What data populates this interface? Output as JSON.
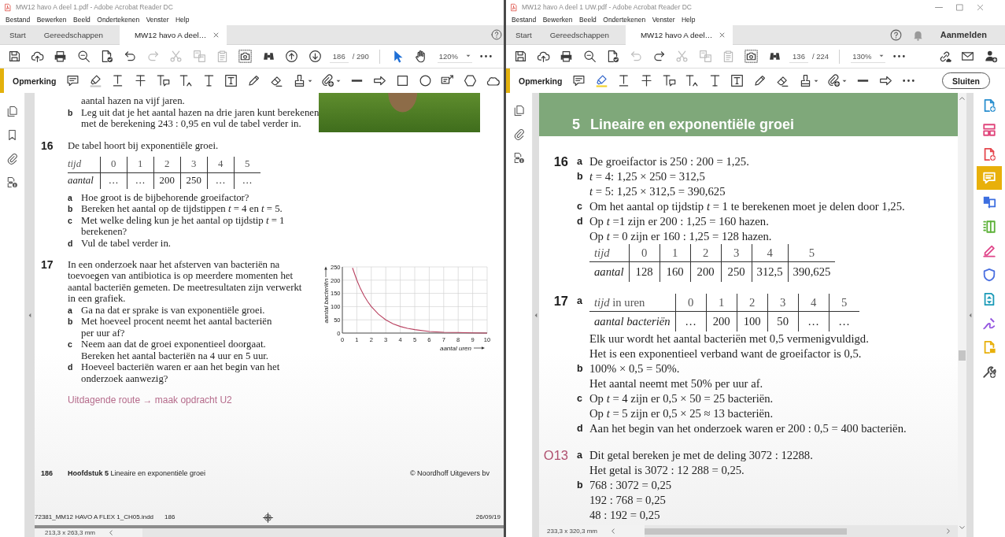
{
  "windows": [
    {
      "title": "MW12 havo A deel 1.pdf - Adobe Acrobat Reader DC",
      "menu": [
        "Bestand",
        "Bewerken",
        "Beeld",
        "Ondertekenen",
        "Venster",
        "Help"
      ],
      "tabs": [
        {
          "label": "Start",
          "selected": false
        },
        {
          "label": "Gereedschappen",
          "selected": false
        },
        {
          "label": "MW12 havo A deel…",
          "selected": true
        }
      ],
      "header_actions": [
        {
          "kind": "help"
        }
      ],
      "toolbar": {
        "tools": [
          {
            "kind": "save",
            "disabled": false
          },
          {
            "kind": "upload",
            "disabled": false
          },
          {
            "kind": "print",
            "disabled": false
          },
          {
            "kind": "zoom-out",
            "disabled": false
          },
          {
            "kind": "sign",
            "disabled": false
          },
          {
            "kind": "undo",
            "disabled": false
          },
          {
            "kind": "redo",
            "disabled": true
          },
          {
            "kind": "cut",
            "disabled": true
          },
          {
            "kind": "copy-pages",
            "disabled": true
          },
          {
            "kind": "clipboard",
            "disabled": true
          },
          {
            "kind": "snapshot",
            "disabled": false
          },
          {
            "kind": "find",
            "disabled": false
          },
          {
            "kind": "page-up",
            "disabled": false
          },
          {
            "kind": "page-down",
            "disabled": false
          }
        ],
        "page": "186",
        "page_total": "/ 290",
        "modes": [
          {
            "kind": "pointer",
            "selected": true
          },
          {
            "kind": "hand",
            "selected": false
          }
        ],
        "zoom": "120%"
      },
      "comment_bar": {
        "label": "Opmerking",
        "tools": [
          {
            "kind": "comment",
            "selected": false
          },
          {
            "kind": "highlight",
            "selected": false
          },
          {
            "kind": "underline",
            "selected": false
          },
          {
            "kind": "strikethrough",
            "selected": false
          },
          {
            "kind": "replace-text",
            "selected": false
          },
          {
            "kind": "insert-text",
            "selected": false
          },
          {
            "kind": "add-text",
            "selected": false
          },
          {
            "kind": "text-box",
            "selected": false
          },
          {
            "kind": "pencil",
            "selected": false
          },
          {
            "kind": "eraser",
            "selected": false
          },
          {
            "kind": "stamp",
            "selected": false
          },
          {
            "kind": "attach",
            "selected": false
          },
          {
            "kind": "line",
            "selected": false
          },
          {
            "kind": "arrow",
            "selected": false
          },
          {
            "kind": "rectangle",
            "selected": false
          },
          {
            "kind": "oval",
            "selected": false
          },
          {
            "kind": "callout",
            "selected": false
          },
          {
            "kind": "polygon",
            "selected": false
          },
          {
            "kind": "cloud",
            "selected": false
          }
        ]
      },
      "side_rail": [
        {
          "kind": "pages"
        },
        {
          "kind": "bookmarks"
        },
        {
          "kind": "attachments"
        },
        {
          "kind": "document-info"
        }
      ],
      "document": {
        "kind": "exercises",
        "photo": true,
        "continuation": [
          {
            "text": "aantal hazen na vijf jaren."
          },
          {
            "letter": "b",
            "text": "Leg uit dat je het aantal hazen na drie jaren kunt berekenen\nmet de berekening 243 : 0,95 en vul de tabel verder in."
          }
        ],
        "exercises": [
          {
            "number": "16",
            "intro": "De tabel hoort bij exponentiële groei.",
            "table": {
              "rows": [
                {
                  "label": "tijd",
                  "italic": true,
                  "cells": [
                    "0",
                    "1",
                    "2",
                    "3",
                    "4",
                    "5"
                  ]
                },
                {
                  "label": "aantal",
                  "italic": true,
                  "cells": [
                    "…",
                    "…",
                    "200",
                    "250",
                    "…",
                    "…"
                  ]
                }
              ]
            },
            "questions": [
              {
                "letter": "a",
                "text": "Hoe groot is de bijbehorende groeifactor?"
              },
              {
                "letter": "b",
                "text": "Bereken het aantal op de tijdstippen *t* = 4 en *t* = 5."
              },
              {
                "letter": "c",
                "text": "Met welke deling kun je het aantal op tijdstip *t* = 1\nberekenen?"
              },
              {
                "letter": "d",
                "text": "Vul de tabel verder in."
              }
            ]
          },
          {
            "number": "17",
            "intro": "In een onderzoek naar het afsterven van bacteriën na\ntoevoegen van antibiotica is op meerdere momenten het\naantal bacteriën gemeten. De meetresultaten zijn verwerkt\nin een grafiek.",
            "questions": [
              {
                "letter": "a",
                "text": "Ga na dat er sprake is van exponentiële groei."
              },
              {
                "letter": "b",
                "text": "Met hoeveel procent neemt het aantal bacteriën\nper uur af?"
              },
              {
                "letter": "c",
                "text": "Neem aan dat de groei exponentieel doorgaat.\nBereken het aantal bacteriën na 4 uur en 5 uur."
              },
              {
                "letter": "d",
                "text": "Hoeveel bacteriën waren er aan het begin van het\nonderzoek aanwezig?"
              }
            ],
            "chart_data": {
              "type": "line",
              "xlabel": "aantal uren",
              "ylabel": "aantal bacteriën",
              "x": [
                0.7,
                1,
                1.25,
                1.5,
                1.75,
                2,
                2.5,
                3,
                3.5,
                4,
                4.5,
                5,
                6,
                7,
                8,
                9,
                10
              ],
              "values": [
                246,
                200,
                168,
                141,
                119,
                100,
                71,
                50,
                35,
                25,
                18,
                13,
                6,
                3,
                2,
                1,
                0
              ],
              "xlim": [
                0,
                10
              ],
              "ylim": [
                0,
                250
              ],
              "xticks": [
                0,
                1,
                2,
                3,
                4,
                5,
                6,
                7,
                8,
                9,
                10
              ],
              "yticks": [
                0,
                50,
                100,
                150,
                200,
                250
              ],
              "grid": true
            }
          }
        ],
        "route": "Uitdagende route → maak opdracht U2",
        "footer": {
          "page": "186",
          "chapter": "**Hoofdstuk 5** Lineaire en exponentiële groei",
          "copyright": "© Noordhoff Uitgevers bv"
        },
        "slug": {
          "file": "72381_MM12 HAVO A FLEX 1_CH05.indd",
          "page": "186",
          "date": "26/09/19"
        }
      },
      "status": "213,3 x 263,3 mm"
    },
    {
      "title": "MW12 havo A deel 1 UW.pdf - Adobe Acrobat Reader DC",
      "window_controls": true,
      "menu": [
        "Bestand",
        "Bewerken",
        "Beeld",
        "Ondertekenen",
        "Venster",
        "Help"
      ],
      "tabs": [
        {
          "label": "Start",
          "selected": false
        },
        {
          "label": "Gereedschappen",
          "selected": false
        },
        {
          "label": "MW12 havo A deel…",
          "selected": true
        }
      ],
      "header_actions": [
        {
          "kind": "help"
        },
        {
          "kind": "notifications"
        },
        {
          "kind": "sign-in",
          "label": "Aanmelden"
        }
      ],
      "toolbar": {
        "tools": [
          {
            "kind": "save",
            "disabled": false
          },
          {
            "kind": "upload",
            "disabled": false
          },
          {
            "kind": "print",
            "disabled": false
          },
          {
            "kind": "zoom-out",
            "disabled": false
          },
          {
            "kind": "sign",
            "disabled": false
          },
          {
            "kind": "undo",
            "disabled": true
          },
          {
            "kind": "redo",
            "disabled": false
          },
          {
            "kind": "cut",
            "disabled": true
          },
          {
            "kind": "copy-pages",
            "disabled": true
          },
          {
            "kind": "clipboard",
            "disabled": true
          },
          {
            "kind": "snapshot",
            "disabled": false
          },
          {
            "kind": "find",
            "disabled": false
          }
        ],
        "page": "136",
        "page_total": "/ 224",
        "zoom": "130%",
        "trailing_tools": [
          {
            "kind": "share-link"
          },
          {
            "kind": "mail"
          },
          {
            "kind": "add-user"
          }
        ]
      },
      "comment_bar": {
        "label": "Opmerking",
        "tools": [
          {
            "kind": "comment",
            "selected": false
          },
          {
            "kind": "highlight",
            "selected": true
          },
          {
            "kind": "underline",
            "selected": false
          },
          {
            "kind": "strikethrough",
            "selected": false
          },
          {
            "kind": "replace-text",
            "selected": false
          },
          {
            "kind": "insert-text",
            "selected": false
          },
          {
            "kind": "add-text",
            "selected": false
          },
          {
            "kind": "text-box",
            "selected": false
          },
          {
            "kind": "pencil",
            "selected": false
          },
          {
            "kind": "eraser",
            "selected": false
          },
          {
            "kind": "stamp",
            "selected": false
          },
          {
            "kind": "attach",
            "selected": false
          },
          {
            "kind": "line",
            "selected": false
          },
          {
            "kind": "arrow",
            "selected": false
          },
          {
            "kind": "more",
            "selected": false
          }
        ],
        "close_label": "Sluiten"
      },
      "side_rail": [
        {
          "kind": "pages"
        },
        {
          "kind": "attachments"
        },
        {
          "kind": "document-info"
        }
      ],
      "document": {
        "kind": "answers",
        "banner": {
          "number": "5",
          "title": "Lineaire en exponentiële groei"
        },
        "answers": [
          {
            "number": "16",
            "kind": "core",
            "parts": [
              {
                "letter": "a",
                "content": [
                  {
                    "kind": "line",
                    "text": "De groeifactor is 250 : 200 = 1,25."
                  }
                ]
              },
              {
                "letter": "b",
                "content": [
                  {
                    "kind": "line",
                    "text": "*t* = 4: 1,25 × 250 = 312,5"
                  },
                  {
                    "kind": "line",
                    "text": "*t* = 5: 1,25 × 312,5 = 390,625"
                  }
                ]
              },
              {
                "letter": "c",
                "content": [
                  {
                    "kind": "line",
                    "text": "Om het aantal op tijdstip *t* = 1 te berekenen moet je delen door 1,25."
                  }
                ]
              },
              {
                "letter": "d",
                "content": [
                  {
                    "kind": "line",
                    "text": "Op *t* =1 zijn er 200 : 1,25 = 160 hazen."
                  },
                  {
                    "kind": "line",
                    "text": "Op *t* = 0 zijn er 160 : 1,25 = 128 hazen."
                  },
                  {
                    "kind": "table",
                    "rows": [
                      {
                        "label": "tijd",
                        "italic": true,
                        "cells": [
                          "0",
                          "1",
                          "2",
                          "3",
                          "4",
                          "5"
                        ]
                      },
                      {
                        "label": "aantal",
                        "italic": true,
                        "cells": [
                          "128",
                          "160",
                          "200",
                          "250",
                          "312,5",
                          "390,625"
                        ]
                      }
                    ]
                  }
                ]
              }
            ]
          },
          {
            "number": "17",
            "kind": "core",
            "parts": [
              {
                "letter": "a",
                "content": [
                  {
                    "kind": "table",
                    "rows": [
                      {
                        "label": "*tijd* in uren",
                        "italic": false,
                        "cells": [
                          "0",
                          "1",
                          "2",
                          "3",
                          "4",
                          "5"
                        ]
                      },
                      {
                        "label": "aantal bacteriën",
                        "italic": true,
                        "cells": [
                          "…",
                          "200",
                          "100",
                          "50",
                          "…",
                          "…"
                        ]
                      }
                    ]
                  },
                  {
                    "kind": "line",
                    "text": "Elk uur wordt het aantal bacteriën met 0,5 vermenigvuldigd."
                  },
                  {
                    "kind": "line",
                    "text": "Het is een exponentieel verband want de groeifactor is 0,5."
                  }
                ]
              },
              {
                "letter": "b",
                "content": [
                  {
                    "kind": "line",
                    "text": "100% × 0,5 = 50%."
                  },
                  {
                    "kind": "line",
                    "text": "Het aantal neemt met 50% per uur af."
                  }
                ]
              },
              {
                "letter": "c",
                "content": [
                  {
                    "kind": "line",
                    "text": "Op *t* = 4 zijn er 0,5 × 50 = 25 bacteriën."
                  },
                  {
                    "kind": "line",
                    "text": "Op *t* = 5 zijn er 0,5 × 25 ≈ 13 bacteriën."
                  }
                ]
              },
              {
                "letter": "d",
                "content": [
                  {
                    "kind": "line",
                    "text": "Aan het begin van het onderzoek waren er 200 : 0,5 = 400 bacteriën."
                  }
                ]
              }
            ]
          },
          {
            "number": "O13",
            "kind": "practice",
            "parts": [
              {
                "letter": "a",
                "content": [
                  {
                    "kind": "line",
                    "text": "Dit getal bereken je met de deling 3072 : 12288."
                  },
                  {
                    "kind": "line",
                    "text": "Het getal is 3072 : 12 288 = 0,25."
                  }
                ]
              },
              {
                "letter": "b",
                "content": [
                  {
                    "kind": "line",
                    "text": "768 : 3072 = 0,25"
                  },
                  {
                    "kind": "line",
                    "text": "192 : 768 = 0,25"
                  },
                  {
                    "kind": "line",
                    "text": "48 : 192 = 0,25"
                  }
                ]
              }
            ]
          }
        ]
      },
      "tools_panel": [
        {
          "kind": "create-pdf",
          "color": "#2a8fcf",
          "selected": false
        },
        {
          "kind": "organize",
          "color": "#e0457b",
          "selected": false
        },
        {
          "kind": "export",
          "color": "#e5484f",
          "selected": false
        },
        {
          "kind": "comment",
          "color": "#e8b00b",
          "selected": true
        },
        {
          "kind": "combine",
          "color": "#3d6fe0",
          "selected": false
        },
        {
          "kind": "compress",
          "color": "#5cb138",
          "selected": false
        },
        {
          "kind": "fill-sign",
          "color": "#e0468a",
          "selected": false
        },
        {
          "kind": "protect",
          "color": "#4a6fe0",
          "selected": false
        },
        {
          "kind": "send-track",
          "color": "#1c9bb8",
          "selected": false
        },
        {
          "kind": "sign",
          "color": "#9557e0",
          "selected": false
        },
        {
          "kind": "share",
          "color": "#e8b00b",
          "selected": false
        },
        {
          "kind": "more-tools",
          "color": "#4a4a4a",
          "selected": false
        }
      ],
      "status": "233,3 x 320,3 mm"
    }
  ]
}
